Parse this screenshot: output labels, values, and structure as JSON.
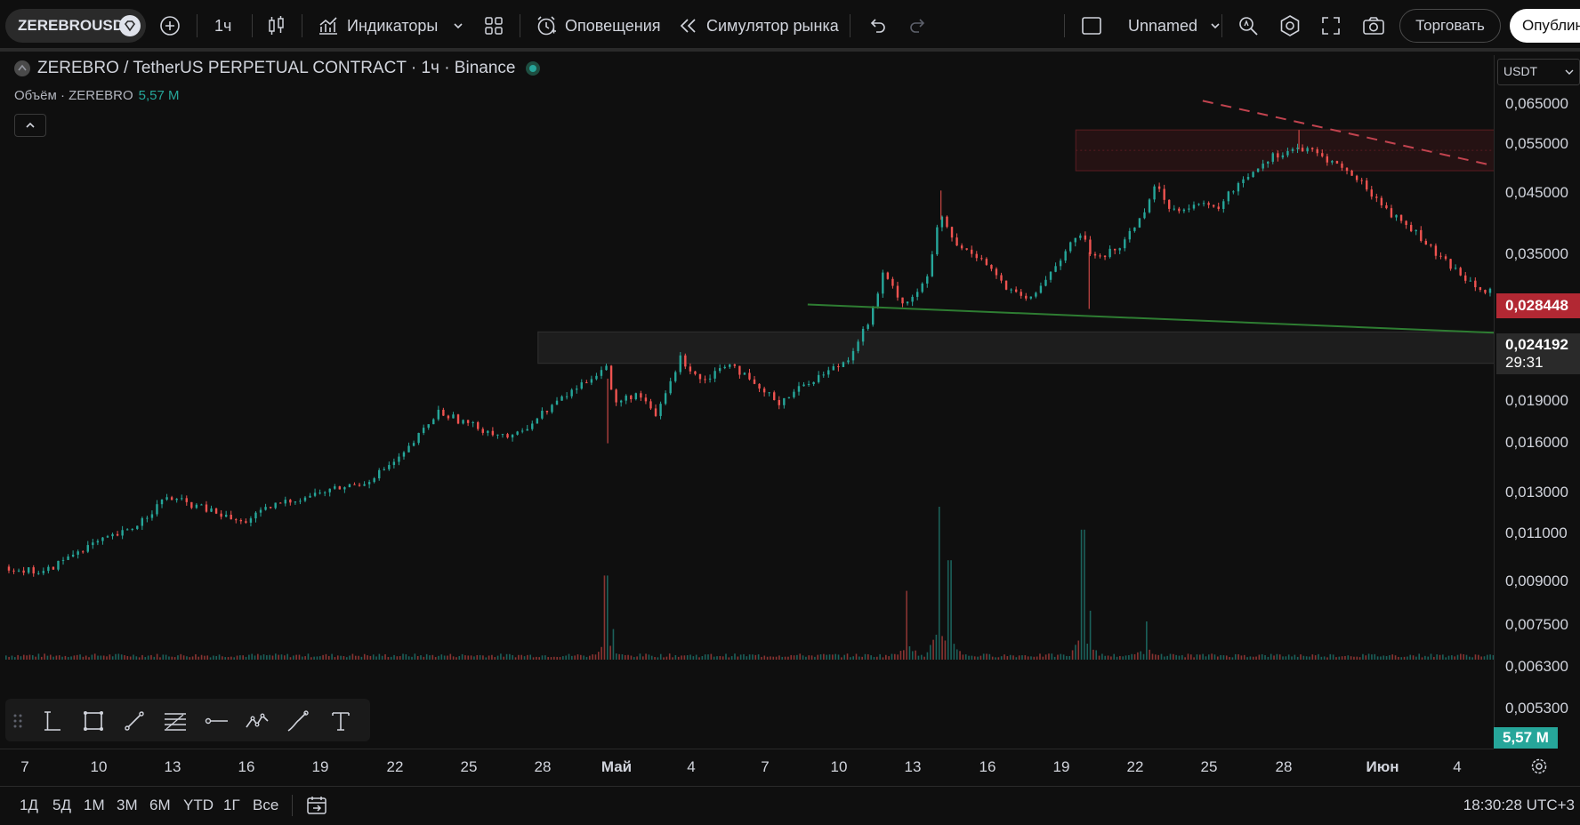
{
  "toolbar": {
    "symbol": "ZEREBROUSD",
    "interval": "1ч",
    "indicators_label": "Индикаторы",
    "alerts_label": "Оповещения",
    "replay_label": "Симулятор рынка",
    "layout_name": "Unnamed",
    "trade_label": "Торговать",
    "publish_label": "Опублин"
  },
  "legend": {
    "title": "ZEREBRO / TetherUS PERPETUAL CONTRACT · 1ч · Binance",
    "volume_label": "Объём · ZEREBRO",
    "volume_value": "5,57 M"
  },
  "price_axis": {
    "currency": "USDT",
    "ticks": [
      "0,065000",
      "0,055000",
      "0,045000",
      "0,035000",
      "0,019000",
      "0,016000",
      "0,013000",
      "0,011000",
      "0,009000",
      "0,007500",
      "0,006300",
      "0,005300"
    ],
    "alert_price": "0,028448",
    "last_price": "0,024192",
    "countdown": "29:31",
    "volume_badge": "5,57 M"
  },
  "time_axis": {
    "ticks": [
      "7",
      "10",
      "13",
      "16",
      "19",
      "22",
      "25",
      "28",
      "Май",
      "4",
      "7",
      "10",
      "13",
      "16",
      "19",
      "22",
      "25",
      "28",
      "Июн",
      "4"
    ]
  },
  "bottom": {
    "ranges": [
      "1Д",
      "5Д",
      "1M",
      "3M",
      "6M",
      "YTD",
      "1Г",
      "Все"
    ],
    "clock": "18:30:28 UTC+3"
  },
  "colors": {
    "up": "#26a69a",
    "down": "#ef5350",
    "background": "#0f0f0f",
    "alert_badge": "#b22833",
    "support_line": "#2e7d32",
    "resistance_line": "#c2434f"
  },
  "chart_data": {
    "type": "candlestick",
    "scale": "log",
    "ylim": [
      0.0048,
      0.072
    ],
    "x_ticks": [
      "7",
      "10",
      "13",
      "16",
      "19",
      "22",
      "25",
      "28",
      "Май",
      "4",
      "7",
      "10",
      "13",
      "16",
      "19",
      "22",
      "25",
      "28",
      "Июн",
      "4"
    ],
    "price_path": [
      {
        "t": 0,
        "p": 0.007
      },
      {
        "t": 1.5,
        "p": 0.0068
      },
      {
        "t": 3,
        "p": 0.0076
      },
      {
        "t": 5,
        "p": 0.0083
      },
      {
        "t": 6.5,
        "p": 0.0097
      },
      {
        "t": 8,
        "p": 0.0092
      },
      {
        "t": 9.5,
        "p": 0.0086
      },
      {
        "t": 11,
        "p": 0.0094
      },
      {
        "t": 13,
        "p": 0.01
      },
      {
        "t": 14.5,
        "p": 0.0104
      },
      {
        "t": 16,
        "p": 0.0117
      },
      {
        "t": 17.5,
        "p": 0.0145
      },
      {
        "t": 19,
        "p": 0.0135
      },
      {
        "t": 20.5,
        "p": 0.0128
      },
      {
        "t": 22,
        "p": 0.0148
      },
      {
        "t": 23.5,
        "p": 0.0168
      },
      {
        "t": 24.3,
        "p": 0.018
      },
      {
        "t": 24.6,
        "p": 0.015
      },
      {
        "t": 25.5,
        "p": 0.0158
      },
      {
        "t": 26.3,
        "p": 0.0142
      },
      {
        "t": 27.3,
        "p": 0.0186
      },
      {
        "t": 28.2,
        "p": 0.0168
      },
      {
        "t": 29.3,
        "p": 0.0184
      },
      {
        "t": 30.3,
        "p": 0.0163
      },
      {
        "t": 31.3,
        "p": 0.0152
      },
      {
        "t": 32.5,
        "p": 0.0167
      },
      {
        "t": 34,
        "p": 0.0184
      },
      {
        "t": 35,
        "p": 0.0225
      },
      {
        "t": 35.5,
        "p": 0.0276
      },
      {
        "t": 36.4,
        "p": 0.024
      },
      {
        "t": 37.3,
        "p": 0.027
      },
      {
        "t": 37.8,
        "p": 0.0365
      },
      {
        "t": 38.5,
        "p": 0.0315
      },
      {
        "t": 39.5,
        "p": 0.03
      },
      {
        "t": 40.6,
        "p": 0.0255
      },
      {
        "t": 41.5,
        "p": 0.0245
      },
      {
        "t": 42.5,
        "p": 0.029
      },
      {
        "t": 43.5,
        "p": 0.0335
      },
      {
        "t": 44,
        "p": 0.03
      },
      {
        "t": 45,
        "p": 0.031
      },
      {
        "t": 46,
        "p": 0.0365
      },
      {
        "t": 46.5,
        "p": 0.042
      },
      {
        "t": 47.2,
        "p": 0.0375
      },
      {
        "t": 48.2,
        "p": 0.0385
      },
      {
        "t": 49,
        "p": 0.0375
      },
      {
        "t": 50,
        "p": 0.043
      },
      {
        "t": 51.2,
        "p": 0.048
      },
      {
        "t": 52.2,
        "p": 0.05
      },
      {
        "t": 53,
        "p": 0.049
      },
      {
        "t": 54,
        "p": 0.046
      },
      {
        "t": 55,
        "p": 0.042
      },
      {
        "t": 56,
        "p": 0.037
      },
      {
        "t": 57,
        "p": 0.034
      },
      {
        "t": 58,
        "p": 0.03
      },
      {
        "t": 59,
        "p": 0.0275
      },
      {
        "t": 60,
        "p": 0.0255
      },
      {
        "t": 60.8,
        "p": 0.0285
      },
      {
        "t": 61.5,
        "p": 0.0262
      },
      {
        "t": 62.5,
        "p": 0.024
      },
      {
        "t": 63.5,
        "p": 0.0218
      },
      {
        "t": 64.5,
        "p": 0.023
      },
      {
        "t": 65.5,
        "p": 0.0218
      },
      {
        "t": 66.5,
        "p": 0.0216
      },
      {
        "t": 67.5,
        "p": 0.0213
      },
      {
        "t": 68.5,
        "p": 0.0207
      },
      {
        "t": 69.5,
        "p": 0.0203
      },
      {
        "t": 70.5,
        "p": 0.0207
      },
      {
        "t": 71.5,
        "p": 0.0202
      },
      {
        "t": 72.5,
        "p": 0.0208
      },
      {
        "t": 73.5,
        "p": 0.0205
      },
      {
        "t": 74.5,
        "p": 0.0208
      },
      {
        "t": 75.3,
        "p": 0.0225
      },
      {
        "t": 75.9,
        "p": 0.0268
      },
      {
        "t": 76.7,
        "p": 0.0225
      },
      {
        "t": 77.7,
        "p": 0.0215
      },
      {
        "t": 78.6,
        "p": 0.0208
      },
      {
        "t": 79.5,
        "p": 0.0203
      },
      {
        "t": 80.5,
        "p": 0.0212
      },
      {
        "t": 81.5,
        "p": 0.0226
      },
      {
        "t": 82.5,
        "p": 0.0241
      }
    ],
    "volume_spikes": [
      {
        "t": 24.3,
        "v": 0.55
      },
      {
        "t": 24.6,
        "v": 0.2
      },
      {
        "t": 36.5,
        "v": 0.45
      },
      {
        "t": 37.8,
        "v": 1.0
      },
      {
        "t": 38.2,
        "v": 0.65
      },
      {
        "t": 43.6,
        "v": 0.85
      },
      {
        "t": 43.9,
        "v": 0.32
      },
      {
        "t": 46.2,
        "v": 0.25
      },
      {
        "t": 60.8,
        "v": 0.08
      },
      {
        "t": 75.9,
        "v": 0.23
      }
    ],
    "support_zone": {
      "t_start": 21,
      "t_end": 82.5,
      "p_low": 0.0182,
      "p_high": 0.0211
    },
    "resistance_zone": {
      "t_start": 43,
      "t_end": 83.5,
      "p_low": 0.045,
      "p_high": 0.0545
    },
    "support_line": {
      "t1": 32.5,
      "p1": 0.024,
      "t2": 82.5,
      "p2": 0.0189
    },
    "resistance_line": {
      "t1": 48.5,
      "p1": 0.0625,
      "t2": 85.8,
      "p2": 0.0238
    },
    "projection": [
      {
        "t": 82.3,
        "p": 0.0241
      },
      {
        "t": 83.0,
        "p": 0.0275
      },
      {
        "t": 83.3,
        "p": 0.025
      },
      {
        "t": 83.8,
        "p": 0.029
      },
      {
        "t": 84.4,
        "p": 0.047
      }
    ],
    "arrows_up": [
      {
        "t": 73.5
      },
      {
        "t": 80.2
      }
    ],
    "last_price": 0.024192,
    "alert_price": 0.028448
  }
}
